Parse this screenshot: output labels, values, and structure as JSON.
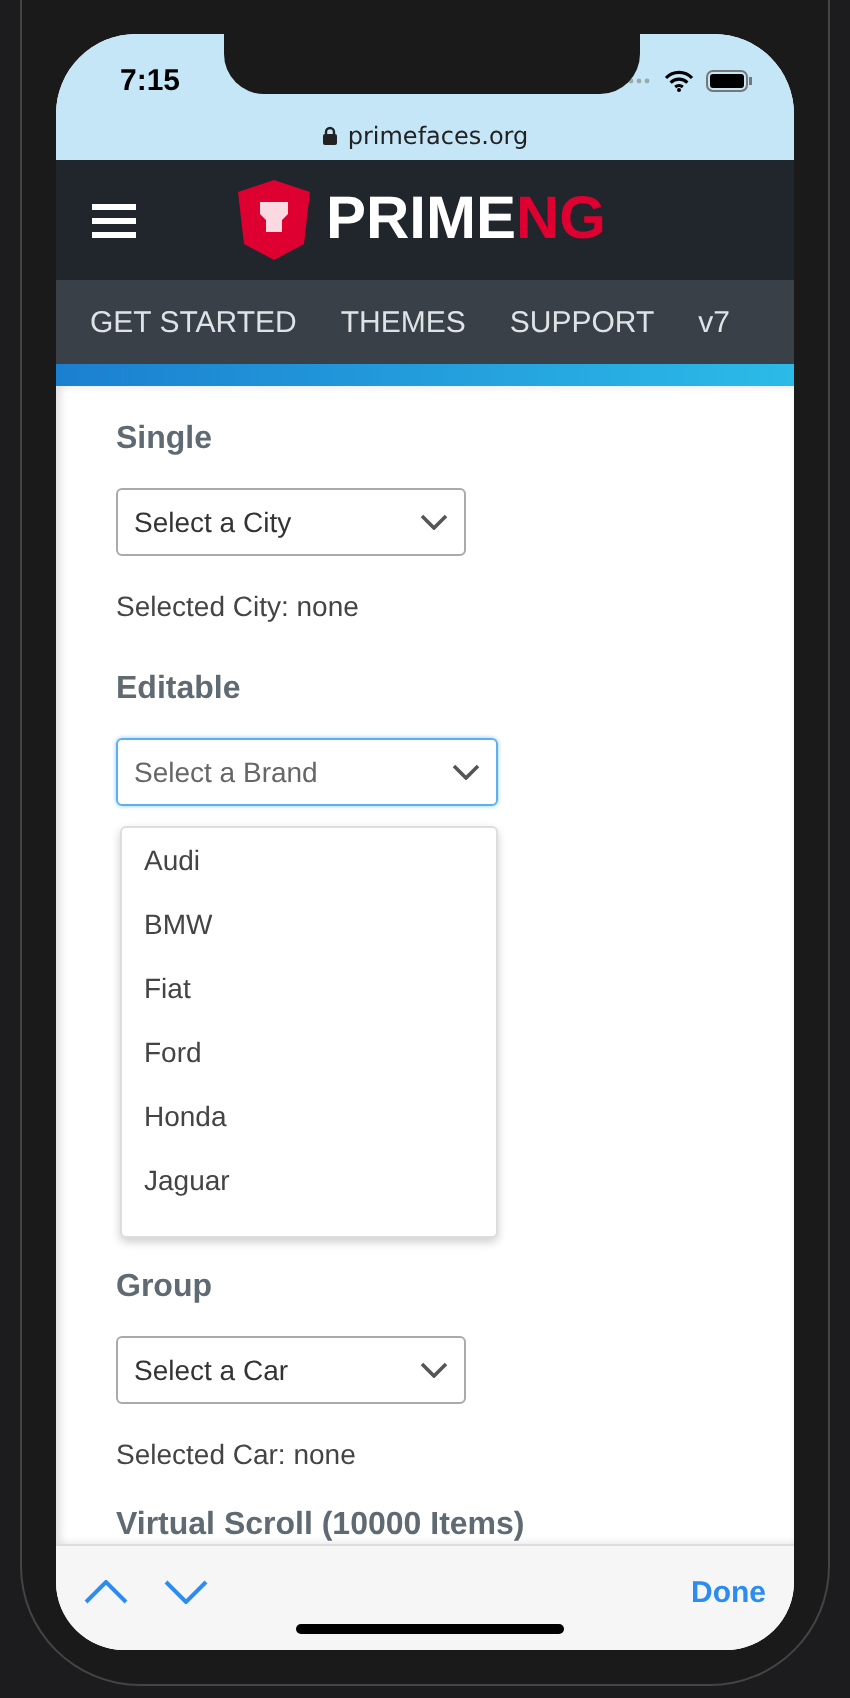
{
  "status_bar": {
    "time": "7:15"
  },
  "address_bar": {
    "url": "primefaces.org"
  },
  "header": {
    "logo_main": "PRIME",
    "logo_accent": "NG"
  },
  "nav": [
    "GET STARTED",
    "THEMES",
    "SUPPORT",
    "v7"
  ],
  "sections": [
    {
      "kind": "dropdown",
      "title": "Single",
      "placeholder": "Select a City",
      "focused": false,
      "note": "Selected City: none"
    },
    {
      "kind": "editable",
      "title": "Editable",
      "placeholder": "Select a Brand",
      "focused": true,
      "options": [
        "Audi",
        "BMW",
        "Fiat",
        "Ford",
        "Honda",
        "Jaguar"
      ]
    },
    {
      "kind": "dropdown",
      "title": "Group",
      "placeholder": "Select a Car",
      "focused": false,
      "note": "Selected Car: none"
    },
    {
      "kind": "heading",
      "title": "Virtual Scroll (10000 Items)"
    }
  ],
  "toolbar": {
    "done": "Done"
  }
}
